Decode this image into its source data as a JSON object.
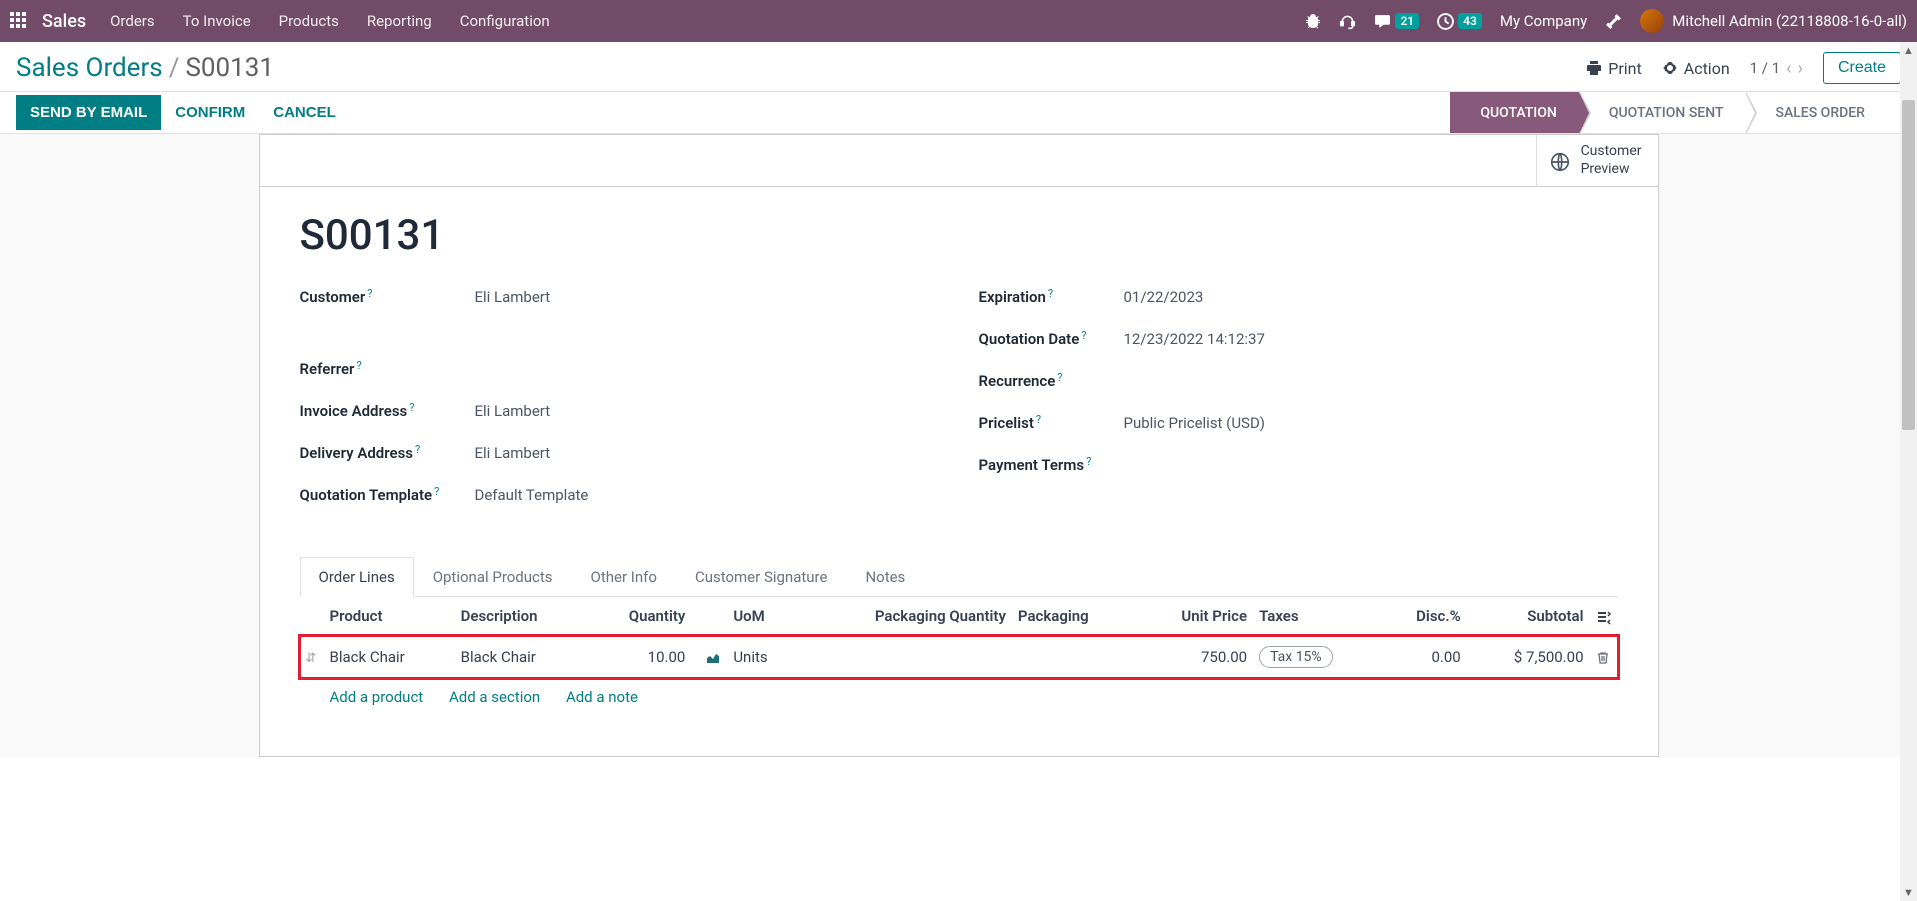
{
  "navbar": {
    "brand": "Sales",
    "menu": [
      "Orders",
      "To Invoice",
      "Products",
      "Reporting",
      "Configuration"
    ],
    "messages_badge": "21",
    "activities_badge": "43",
    "company": "My Company",
    "user": "Mitchell Admin (22118808-16-0-all)"
  },
  "breadcrumb": {
    "parent": "Sales Orders",
    "current": "S00131"
  },
  "toolbar": {
    "print": "Print",
    "action": "Action",
    "pager": "1 / 1",
    "create": "Create"
  },
  "statusbar": {
    "send": "SEND BY EMAIL",
    "confirm": "CONFIRM",
    "cancel": "CANCEL",
    "stages": [
      "QUOTATION",
      "QUOTATION SENT",
      "SALES ORDER"
    ],
    "active_stage": 0
  },
  "sheet": {
    "customer_preview": "Customer\nPreview",
    "title": "S00131",
    "left_fields": [
      {
        "label": "Customer",
        "value": "Eli Lambert",
        "help": true
      },
      {
        "label": "Referrer",
        "value": "",
        "help": true
      },
      {
        "label": "Invoice Address",
        "value": "Eli Lambert",
        "help": true
      },
      {
        "label": "Delivery Address",
        "value": "Eli Lambert",
        "help": true
      },
      {
        "label": "Quotation Template",
        "value": "Default Template",
        "help": true
      }
    ],
    "right_fields": [
      {
        "label": "Expiration",
        "value": "01/22/2023",
        "help": true
      },
      {
        "label": "Quotation Date",
        "value": "12/23/2022 14:12:37",
        "help": true
      },
      {
        "label": "Recurrence",
        "value": "",
        "help": true
      },
      {
        "label": "Pricelist",
        "value": "Public Pricelist (USD)",
        "help": true
      },
      {
        "label": "Payment Terms",
        "value": "",
        "help": true
      }
    ]
  },
  "tabs": [
    "Order Lines",
    "Optional Products",
    "Other Info",
    "Customer Signature",
    "Notes"
  ],
  "order_lines": {
    "columns": [
      "Product",
      "Description",
      "Quantity",
      "UoM",
      "Packaging Quantity",
      "Packaging",
      "Unit Price",
      "Taxes",
      "Disc.%",
      "Subtotal"
    ],
    "rows": [
      {
        "product": "Black Chair",
        "description": "Black Chair",
        "quantity": "10.00",
        "uom": "Units",
        "pkg_qty": "",
        "pkg": "",
        "unit_price": "750.00",
        "taxes": "Tax 15%",
        "disc": "0.00",
        "subtotal": "$ 7,500.00"
      }
    ],
    "add_product": "Add a product",
    "add_section": "Add a section",
    "add_note": "Add a note"
  }
}
